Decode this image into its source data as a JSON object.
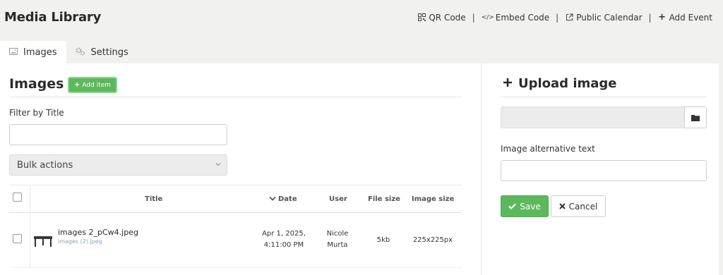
{
  "header": {
    "title": "Media Library",
    "links": {
      "qr_code": "QR Code",
      "embed_code": "Embed Code",
      "public_calendar": "Public Calendar",
      "add_event": "Add Event",
      "separator": "|"
    }
  },
  "tabs": [
    {
      "label": "Images",
      "icon": "image-icon",
      "active": true
    },
    {
      "label": "Settings",
      "icon": "gears-icon",
      "active": false
    }
  ],
  "images_panel": {
    "heading": "Images",
    "add_item_label": "Add item",
    "filter_label": "Filter by Title",
    "filter_value": "",
    "bulk_actions_label": "Bulk actions",
    "columns": {
      "title": "Title",
      "date": "Date",
      "user": "User",
      "file_size": "File size",
      "image_size": "Image size"
    },
    "rows": [
      {
        "file_name": "images 2_pCw4.jpeg",
        "original_name": "images (2).jpeg",
        "date_line1": "Apr 1, 2025,",
        "date_line2": "4:11:00 PM",
        "user_line1": "Nicole",
        "user_line2": "Murta",
        "file_size": "5kb",
        "image_size": "225x225px"
      }
    ]
  },
  "upload_panel": {
    "heading": "Upload image",
    "file_value": "",
    "alt_label": "Image alternative text",
    "alt_value": "",
    "save_label": "Save",
    "cancel_label": "Cancel"
  },
  "colors": {
    "accent_green": "#5cb85c",
    "background": "#f1f1f0"
  }
}
